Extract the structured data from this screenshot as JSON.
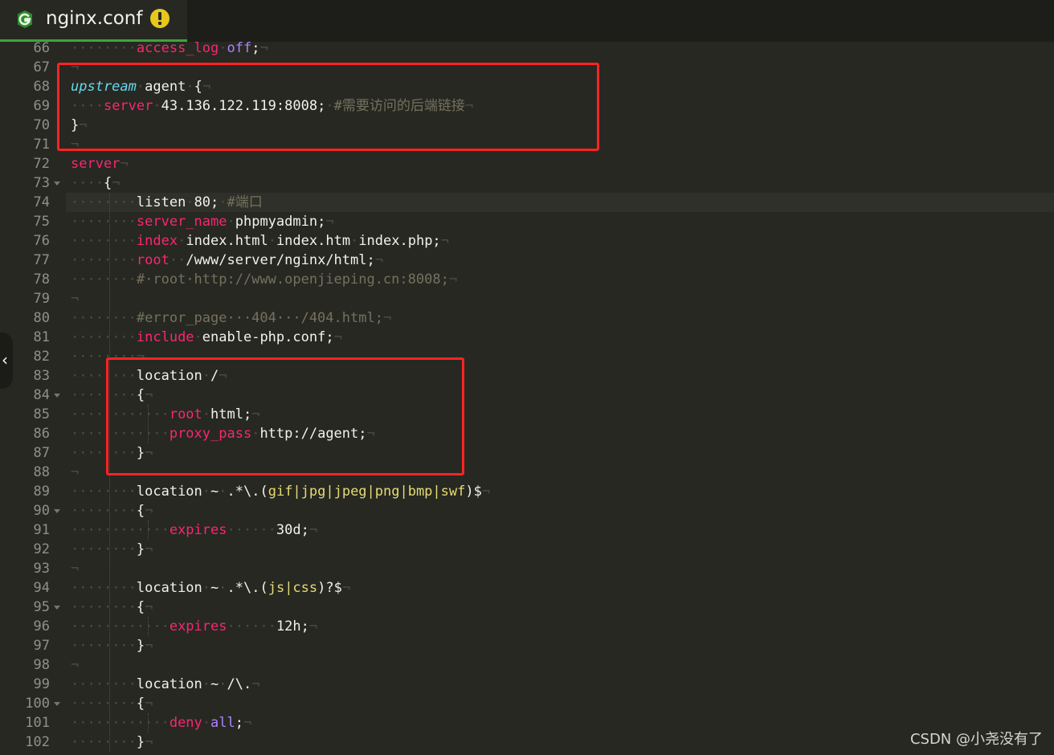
{
  "tab": {
    "title": "nginx.conf",
    "file_icon": "g-letter-icon",
    "status_icon": "warning-icon"
  },
  "colors": {
    "keyword": "#f92672",
    "upstream": "#66d9ef",
    "comment": "#75715e",
    "value": "#ae81ff",
    "regex": "#e6db74",
    "plain": "#f2f2ec",
    "highlight_box": "#ff2323",
    "tab_accent": "#3ea538"
  },
  "watermark": "CSDN @小尧没有了",
  "side_handle": {
    "icon": "chevron-left-icon",
    "glyph": "‹"
  },
  "editor": {
    "first_line": 66,
    "current_line": 74,
    "folds": [
      73,
      84,
      90,
      95,
      100
    ],
    "lines": [
      {
        "ln": "66",
        "tokens": [
          [
            "ws",
            "········"
          ],
          [
            "kw",
            "access_log"
          ],
          [
            "ws",
            "·"
          ],
          [
            "val",
            "off"
          ],
          [
            "pl",
            ";"
          ],
          [
            "ws",
            "¬"
          ]
        ]
      },
      {
        "ln": "67",
        "tokens": [
          [
            "ws",
            "¬"
          ]
        ]
      },
      {
        "ln": "68",
        "tokens": [
          [
            "up",
            "upstream"
          ],
          [
            "ws",
            "·"
          ],
          [
            "pl",
            "agent"
          ],
          [
            "ws",
            "·"
          ],
          [
            "pl",
            "{"
          ],
          [
            "ws",
            "¬"
          ]
        ]
      },
      {
        "ln": "69",
        "tokens": [
          [
            "ws",
            "····"
          ],
          [
            "kw",
            "server"
          ],
          [
            "ws",
            "·"
          ],
          [
            "pl",
            "43.136.122.119:8008;"
          ],
          [
            "ws",
            "·"
          ],
          [
            "cm",
            "#需要访问的后端链接"
          ],
          [
            "ws",
            "¬"
          ]
        ]
      },
      {
        "ln": "70",
        "tokens": [
          [
            "pl",
            "}"
          ],
          [
            "ws",
            "¬"
          ]
        ]
      },
      {
        "ln": "71",
        "tokens": [
          [
            "ws",
            "¬"
          ]
        ]
      },
      {
        "ln": "72",
        "tokens": [
          [
            "kw",
            "server"
          ],
          [
            "ws",
            "¬"
          ]
        ]
      },
      {
        "ln": "73",
        "tokens": [
          [
            "ws",
            "····"
          ],
          [
            "pl",
            "{"
          ],
          [
            "ws",
            "¬"
          ]
        ]
      },
      {
        "ln": "74",
        "tokens": [
          [
            "ws",
            "········"
          ],
          [
            "pl",
            "listen"
          ],
          [
            "ws",
            "·"
          ],
          [
            "pl",
            "80;"
          ],
          [
            "ws",
            "·"
          ],
          [
            "cm",
            "#端口"
          ]
        ]
      },
      {
        "ln": "75",
        "tokens": [
          [
            "ws",
            "········"
          ],
          [
            "kw",
            "server_name"
          ],
          [
            "ws",
            "·"
          ],
          [
            "pl",
            "phpmyadmin;"
          ],
          [
            "ws",
            "¬"
          ]
        ]
      },
      {
        "ln": "76",
        "tokens": [
          [
            "ws",
            "········"
          ],
          [
            "kw",
            "index"
          ],
          [
            "ws",
            "·"
          ],
          [
            "pl",
            "index.html"
          ],
          [
            "ws",
            "·"
          ],
          [
            "pl",
            "index.htm"
          ],
          [
            "ws",
            "·"
          ],
          [
            "pl",
            "index.php;"
          ],
          [
            "ws",
            "¬"
          ]
        ]
      },
      {
        "ln": "77",
        "tokens": [
          [
            "ws",
            "········"
          ],
          [
            "kw",
            "root"
          ],
          [
            "ws",
            "··"
          ],
          [
            "pl",
            "/www/server/nginx/html;"
          ],
          [
            "ws",
            "¬"
          ]
        ]
      },
      {
        "ln": "78",
        "tokens": [
          [
            "ws",
            "········"
          ],
          [
            "cm",
            "#·root·http://www.openjieping.cn:8008;"
          ],
          [
            "ws",
            "¬"
          ]
        ]
      },
      {
        "ln": "79",
        "tokens": [
          [
            "ws",
            "¬"
          ]
        ]
      },
      {
        "ln": "80",
        "tokens": [
          [
            "ws",
            "········"
          ],
          [
            "cm",
            "#error_page···404···/404.html;"
          ],
          [
            "ws",
            "¬"
          ]
        ]
      },
      {
        "ln": "81",
        "tokens": [
          [
            "ws",
            "········"
          ],
          [
            "kw",
            "include"
          ],
          [
            "ws",
            "·"
          ],
          [
            "pl",
            "enable-php.conf;"
          ],
          [
            "ws",
            "¬"
          ]
        ]
      },
      {
        "ln": "82",
        "tokens": [
          [
            "ws",
            "········¬"
          ]
        ]
      },
      {
        "ln": "83",
        "tokens": [
          [
            "ws",
            "········"
          ],
          [
            "pl",
            "location"
          ],
          [
            "ws",
            "·"
          ],
          [
            "pl",
            "/"
          ],
          [
            "ws",
            "¬"
          ]
        ]
      },
      {
        "ln": "84",
        "tokens": [
          [
            "ws",
            "········"
          ],
          [
            "pl",
            "{"
          ],
          [
            "ws",
            "¬"
          ]
        ]
      },
      {
        "ln": "85",
        "tokens": [
          [
            "ws",
            "············"
          ],
          [
            "kw",
            "root"
          ],
          [
            "ws",
            "·"
          ],
          [
            "pl",
            "html;"
          ],
          [
            "ws",
            "¬"
          ]
        ]
      },
      {
        "ln": "86",
        "tokens": [
          [
            "ws",
            "············"
          ],
          [
            "kw",
            "proxy_pass"
          ],
          [
            "ws",
            "·"
          ],
          [
            "pl",
            "http://agent;"
          ],
          [
            "ws",
            "¬"
          ]
        ]
      },
      {
        "ln": "87",
        "tokens": [
          [
            "ws",
            "········"
          ],
          [
            "pl",
            "}"
          ],
          [
            "ws",
            "¬"
          ]
        ]
      },
      {
        "ln": "88",
        "tokens": [
          [
            "ws",
            "¬"
          ]
        ]
      },
      {
        "ln": "89",
        "tokens": [
          [
            "ws",
            "········"
          ],
          [
            "pl",
            "location"
          ],
          [
            "ws",
            "·"
          ],
          [
            "pl",
            "~"
          ],
          [
            "ws",
            "·"
          ],
          [
            "pl",
            ".*\\.("
          ],
          [
            "rx",
            "gif|jpg|jpeg|png|bmp|swf"
          ],
          [
            "pl",
            ")$"
          ],
          [
            "ws",
            "¬"
          ]
        ]
      },
      {
        "ln": "90",
        "tokens": [
          [
            "ws",
            "········"
          ],
          [
            "pl",
            "{"
          ],
          [
            "ws",
            "¬"
          ]
        ]
      },
      {
        "ln": "91",
        "tokens": [
          [
            "ws",
            "············"
          ],
          [
            "kw",
            "expires"
          ],
          [
            "ws",
            "······"
          ],
          [
            "pl",
            "30d;"
          ],
          [
            "ws",
            "¬"
          ]
        ]
      },
      {
        "ln": "92",
        "tokens": [
          [
            "ws",
            "········"
          ],
          [
            "pl",
            "}"
          ],
          [
            "ws",
            "¬"
          ]
        ]
      },
      {
        "ln": "93",
        "tokens": [
          [
            "ws",
            "¬"
          ]
        ]
      },
      {
        "ln": "94",
        "tokens": [
          [
            "ws",
            "········"
          ],
          [
            "pl",
            "location"
          ],
          [
            "ws",
            "·"
          ],
          [
            "pl",
            "~"
          ],
          [
            "ws",
            "·"
          ],
          [
            "pl",
            ".*\\.("
          ],
          [
            "rx",
            "js|css"
          ],
          [
            "pl",
            ")?$"
          ],
          [
            "ws",
            "¬"
          ]
        ]
      },
      {
        "ln": "95",
        "tokens": [
          [
            "ws",
            "········"
          ],
          [
            "pl",
            "{"
          ],
          [
            "ws",
            "¬"
          ]
        ]
      },
      {
        "ln": "96",
        "tokens": [
          [
            "ws",
            "············"
          ],
          [
            "kw",
            "expires"
          ],
          [
            "ws",
            "······"
          ],
          [
            "pl",
            "12h;"
          ],
          [
            "ws",
            "¬"
          ]
        ]
      },
      {
        "ln": "97",
        "tokens": [
          [
            "ws",
            "········"
          ],
          [
            "pl",
            "}"
          ],
          [
            "ws",
            "¬"
          ]
        ]
      },
      {
        "ln": "98",
        "tokens": [
          [
            "ws",
            "¬"
          ]
        ]
      },
      {
        "ln": "99",
        "tokens": [
          [
            "ws",
            "········"
          ],
          [
            "pl",
            "location"
          ],
          [
            "ws",
            "·"
          ],
          [
            "pl",
            "~"
          ],
          [
            "ws",
            "·"
          ],
          [
            "pl",
            "/\\."
          ],
          [
            "ws",
            "¬"
          ]
        ]
      },
      {
        "ln": "100",
        "tokens": [
          [
            "ws",
            "········"
          ],
          [
            "pl",
            "{"
          ],
          [
            "ws",
            "¬"
          ]
        ]
      },
      {
        "ln": "101",
        "tokens": [
          [
            "ws",
            "············"
          ],
          [
            "kw",
            "deny"
          ],
          [
            "ws",
            "·"
          ],
          [
            "val",
            "all"
          ],
          [
            "pl",
            ";"
          ],
          [
            "ws",
            "¬"
          ]
        ]
      },
      {
        "ln": "102",
        "tokens": [
          [
            "ws",
            "········"
          ],
          [
            "pl",
            "}"
          ],
          [
            "ws",
            "¬"
          ]
        ]
      }
    ]
  }
}
